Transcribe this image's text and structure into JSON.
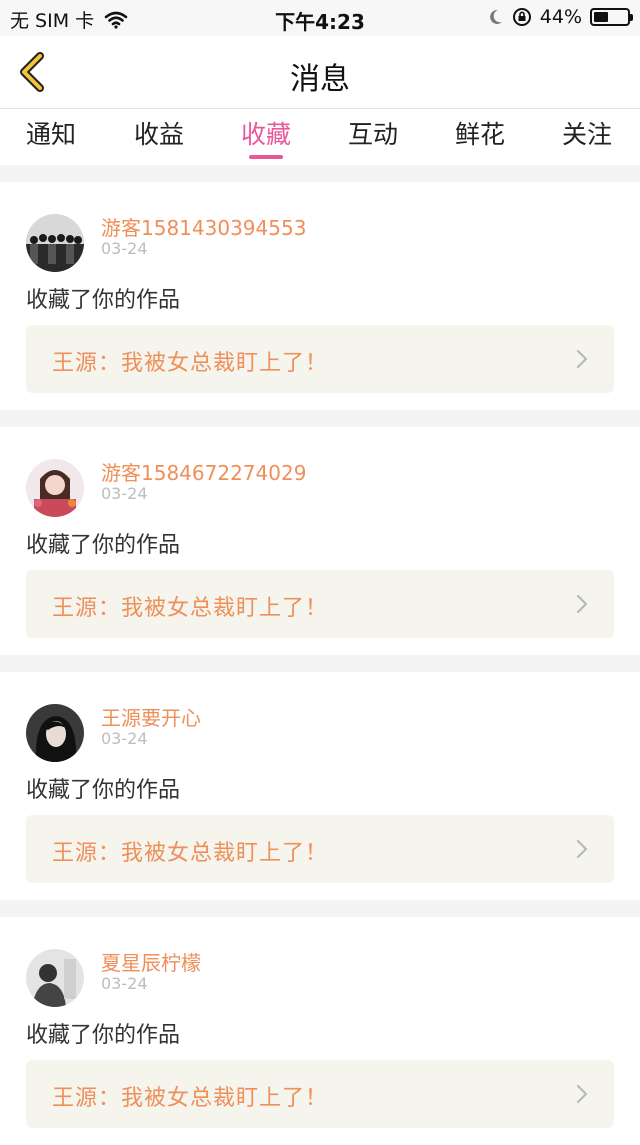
{
  "status_bar": {
    "carrier": "无 SIM 卡",
    "time": "下午4:23",
    "battery_percent": "44%",
    "battery_level": 0.44,
    "icons": [
      "wifi-icon",
      "moon-icon",
      "orientation-lock-icon",
      "battery-icon"
    ]
  },
  "header": {
    "title": "消息",
    "back_icon": "chevron-left-icon",
    "accent_color": "#e8599a"
  },
  "tabs": [
    {
      "label": "通知",
      "active": false
    },
    {
      "label": "收益",
      "active": false
    },
    {
      "label": "收藏",
      "active": true
    },
    {
      "label": "互动",
      "active": false
    },
    {
      "label": "鲜花",
      "active": false
    },
    {
      "label": "关注",
      "active": false
    }
  ],
  "items": [
    {
      "user": "游客1581430394553",
      "date": "03-24",
      "message": "收藏了你的作品",
      "work": "王源：我被女总裁盯上了！"
    },
    {
      "user": "游客1584672274029",
      "date": "03-24",
      "message": "收藏了你的作品",
      "work": "王源：我被女总裁盯上了！"
    },
    {
      "user": "王源要开心",
      "date": "03-24",
      "message": "收藏了你的作品",
      "work": "王源：我被女总裁盯上了！"
    },
    {
      "user": "夏星辰柠檬",
      "date": "03-24",
      "message": "收藏了你的作品",
      "work": "王源：我被女总裁盯上了！"
    }
  ]
}
